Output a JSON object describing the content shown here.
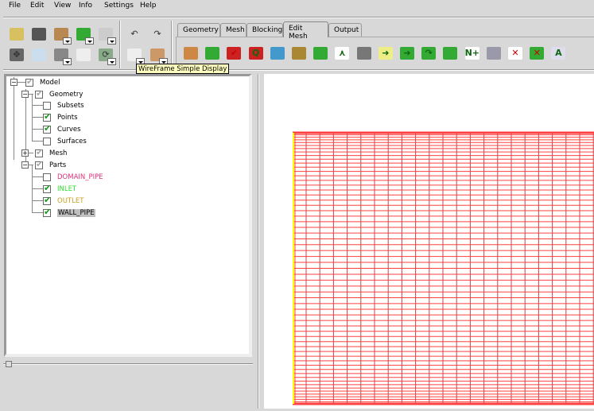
{
  "menu": [
    "File",
    "Edit",
    "View",
    "Info",
    "Settings",
    "Help"
  ],
  "toolbar": {
    "row1": [
      {
        "icon": "open-folder-icon"
      },
      {
        "icon": "save-icon"
      },
      {
        "icon": "open-geometry-icon"
      },
      {
        "icon": "open-mesh-icon"
      },
      {
        "icon": "open-blocking-icon"
      },
      {
        "icon": "undo-icon"
      },
      {
        "icon": "redo-icon"
      }
    ],
    "row2": [
      {
        "icon": "fit-window-icon"
      },
      {
        "icon": "zoom-box-icon"
      },
      {
        "icon": "measure-icon"
      },
      {
        "icon": "local-coord-system-icon"
      },
      {
        "icon": "refresh-icon"
      },
      {
        "icon": "wireframe-display-icon"
      },
      {
        "icon": "solid-display-icon"
      }
    ],
    "tooltip": "WireFrame Simple Display"
  },
  "tabs": [
    {
      "label": "Geometry"
    },
    {
      "label": "Mesh"
    },
    {
      "label": "Blocking"
    },
    {
      "label": "Edit Mesh",
      "active": true
    },
    {
      "label": "Output"
    }
  ],
  "edit_mesh_icons": [
    "create-elements-icon",
    "extrude-mesh-icon",
    "check-mesh-icon",
    "quality-icon",
    "smooth-mesh-icon",
    "smooth-hexa-icon",
    "repair-mesh-icon",
    "merge-nodes-icon",
    "split-mesh-icon",
    "move-nodes-icon",
    "transform-mesh-icon",
    "convert-mesh-icon",
    "adjust-mesh-density-icon",
    "renumber-mesh-icon",
    "reorient-mesh-icon",
    "delete-nodes-icon",
    "delete-elements-icon",
    "edit-distributed-attribute-icon"
  ],
  "tree": {
    "model": "Model",
    "geometry": "Geometry",
    "subsets": "Subsets",
    "points": "Points",
    "curves": "Curves",
    "surfaces": "Surfaces",
    "mesh": "Mesh",
    "parts": "Parts",
    "part_items": [
      {
        "label": "DOMAIN_PIPE",
        "color": "#e0307a",
        "checked": false
      },
      {
        "label": "INLET",
        "color": "#30e030",
        "checked": true
      },
      {
        "label": "OUTLET",
        "color": "#c8a020",
        "checked": true
      },
      {
        "label": "WALL_PIPE",
        "color": "#000000",
        "checked": true,
        "selected": true
      }
    ]
  },
  "colors": {
    "mesh_line": "#ff4040",
    "mesh_vertical": "#c04848",
    "edge": "#ffff00"
  }
}
